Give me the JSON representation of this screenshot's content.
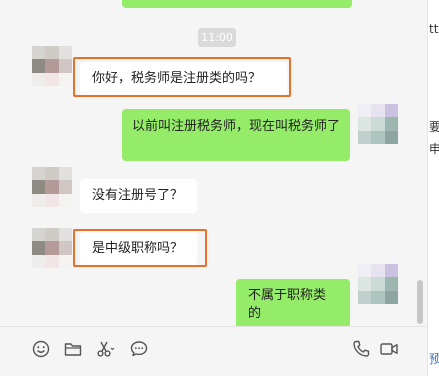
{
  "chat": {
    "time_divider": "11:00",
    "messages": [
      {
        "text": "你好，税务师是注册类的吗？"
      },
      {
        "text": "以前叫注册税务师，现在叫税务师了"
      },
      {
        "text": "没有注册号了？"
      },
      {
        "text": "是中级职称吗？"
      },
      {
        "text": "不属于职称类的"
      }
    ]
  },
  "sidebar": {
    "fragments": [
      "tt",
      "要",
      "申",
      "预"
    ]
  },
  "toolbar": {
    "tools": [
      "emoji-icon",
      "folder-icon",
      "scissors-icon",
      "chat-history-icon",
      "phone-icon",
      "video-icon"
    ]
  },
  "colors": {
    "accent_green": "#95ec69",
    "highlight_orange": "#e8702a"
  }
}
